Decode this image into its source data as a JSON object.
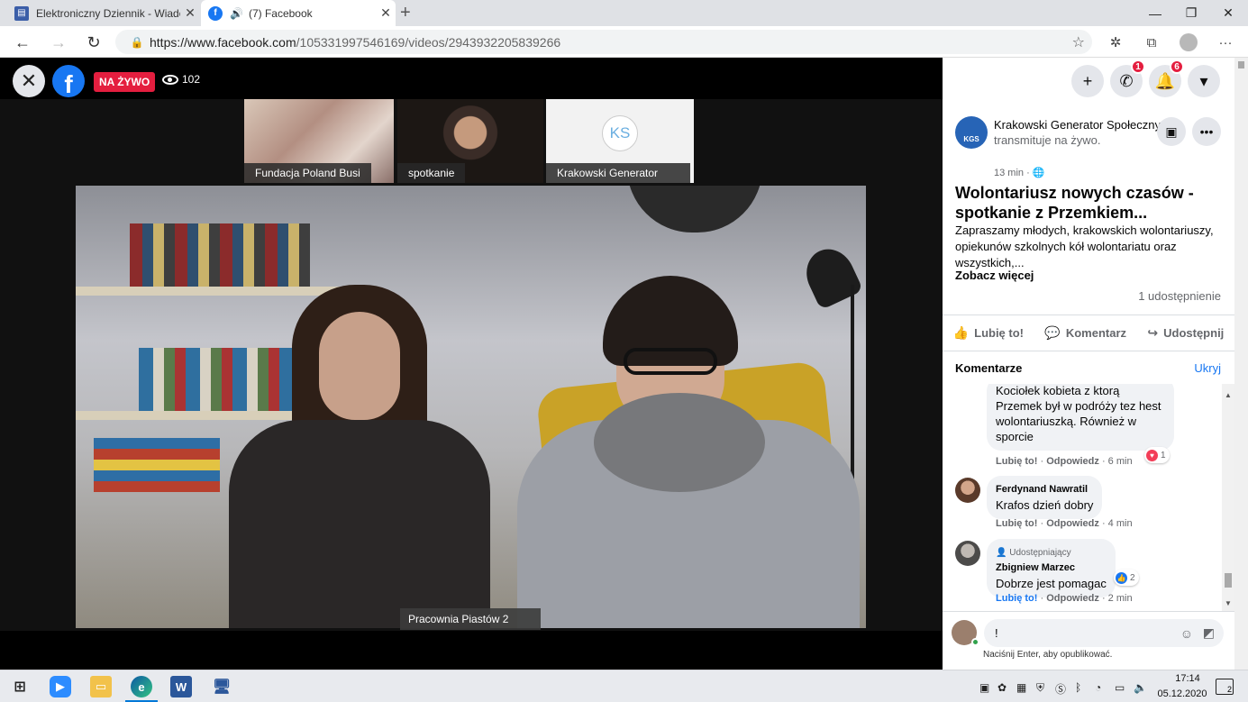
{
  "browser": {
    "tabs": [
      {
        "title": "Elektroniczny Dziennik - Wiadom",
        "icon": "dziennik-favicon"
      },
      {
        "title": "(7) Facebook",
        "icon": "facebook-favicon"
      }
    ],
    "url_base": "https://www.facebook.com",
    "url_path": "/105331997546169/videos/2943932205839266"
  },
  "video": {
    "live_label": "NA ŻYWO",
    "viewer_count": "102",
    "thumbnails": [
      {
        "label": "Fundacja Poland Busi"
      },
      {
        "label": "spotkanie"
      },
      {
        "label": "Krakowski Generator",
        "initials": "KS"
      }
    ],
    "main_label": "Pracownia Piastów 2"
  },
  "fb_header": {
    "messenger_badge": "1",
    "notifications_badge": "6"
  },
  "post": {
    "page_initials": "KGS",
    "page_name": "Krakowski Generator Społeczny",
    "page_action": " transmituje na żywo.",
    "time": "13 min ·",
    "title": "Wolontariusz nowych czasów - spotkanie z Przemkiem...",
    "description": "Zapraszamy młodych, krakowskich wolontariuszy, opiekunów szkolnych kół wolontariatu oraz wszystkich,...",
    "see_more": "Zobacz więcej",
    "shares": "1 udostępnienie",
    "actions": {
      "like": "Lubię to!",
      "comment": "Komentarz",
      "share": "Udostępnij"
    }
  },
  "comments": {
    "header": "Komentarze",
    "hide": "Ukryj",
    "items": [
      {
        "text": "Kociołek kobieta z ktorą Przemek był w podróży tez hest wolontariuszką. Również w sporcie",
        "like": "Lubię to!",
        "reply": "Odpowiedz",
        "time": "6 min",
        "reaction_count": "1"
      },
      {
        "author": "Ferdynand Nawratil",
        "text": "Krafos dzień dobry",
        "like": "Lubię to!",
        "reply": "Odpowiedz",
        "time": "4 min"
      },
      {
        "sharer_label": "Udostępniający",
        "author": "Zbigniew Marzec",
        "text": "Dobrze jest pomagac",
        "like": "Lubię to!",
        "reply": "Odpowiedz",
        "time": "2 min",
        "reaction_count": "2"
      }
    ],
    "composer_value": "!",
    "enter_hint": "Naciśnij Enter, aby opublikować."
  },
  "taskbar": {
    "time": "17:14",
    "date": "05.12.2020",
    "notification_count": "2",
    "word_letter": "W"
  },
  "colors": {
    "facebook_blue": "#1877f2",
    "live_red": "#e41e3f",
    "panel_gray": "#f0f2f5"
  }
}
